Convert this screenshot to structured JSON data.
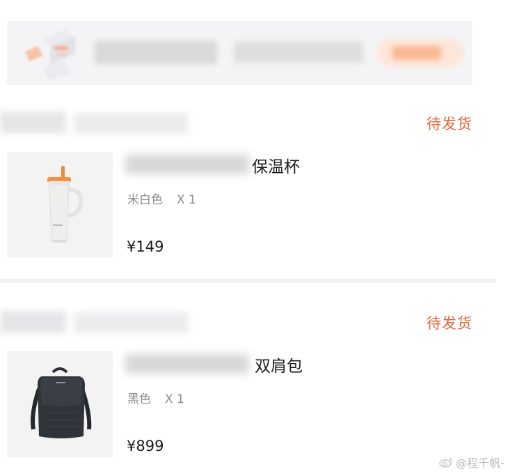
{
  "orders": [
    {
      "status": "待发货",
      "title_visible": "保温杯",
      "spec": "米白色",
      "quantity": "X 1",
      "price": "¥149",
      "thumb_icon": "tumbler-image"
    },
    {
      "status": "待发货",
      "title_visible": "双肩包",
      "spec": "黑色",
      "quantity": "X 1",
      "price": "¥899",
      "thumb_icon": "backpack-image"
    }
  ],
  "watermark": "@程千帆-",
  "colors": {
    "status": "#e7643b",
    "accent_banner": "#f9b894"
  }
}
